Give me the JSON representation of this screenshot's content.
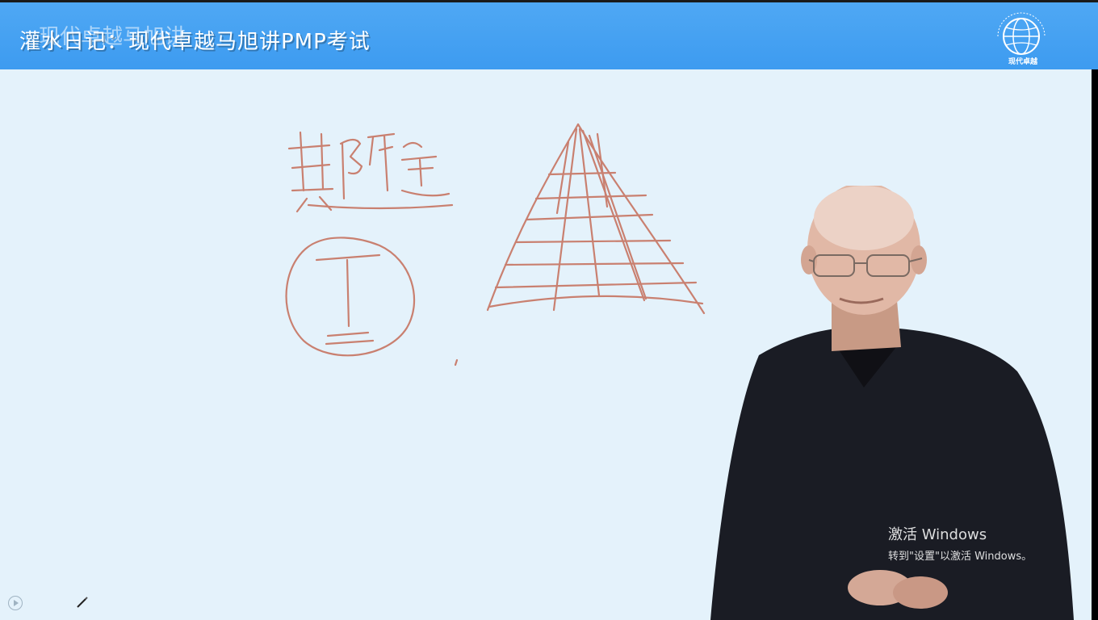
{
  "header": {
    "title": "灌水日记：现代卓越马旭讲PMP考试",
    "ghost_title": "现代卓越马旭讲",
    "logo_label": "现代卓越"
  },
  "watermark": {
    "line1": "激活 Windows",
    "line2": "转到\"设置\"以激活 Windows。"
  },
  "icons": {
    "logo": "globe-logo-icon",
    "play": "play-circle-icon",
    "pen": "pen-icon"
  },
  "colors": {
    "header_bg": "#3d9bf0",
    "board_bg": "#e4f2fb",
    "ink": "#c98070"
  }
}
